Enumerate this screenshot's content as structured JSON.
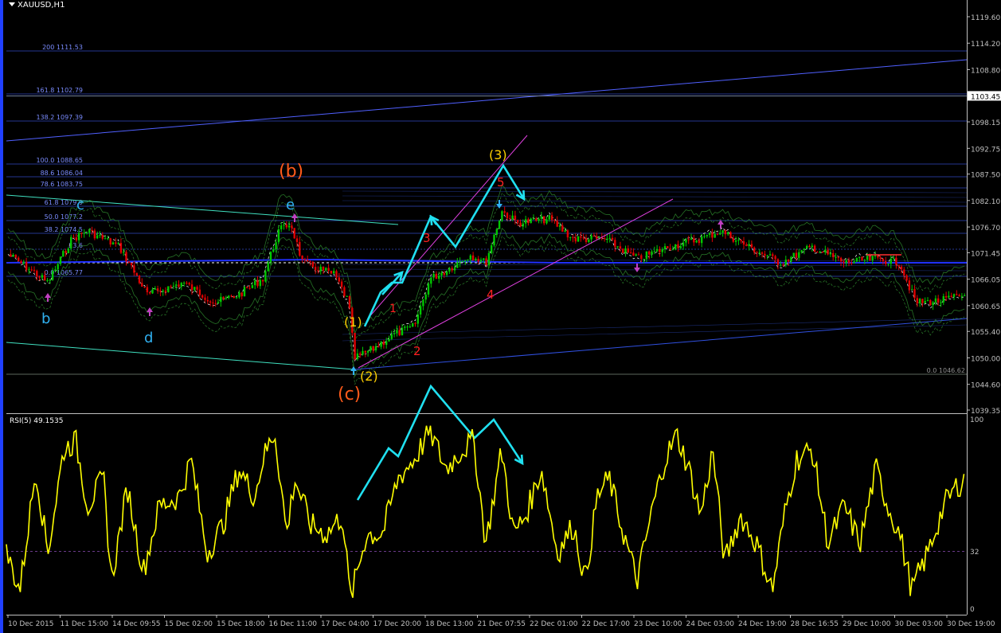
{
  "window": {
    "symbol_title": "XAUUSD,H1"
  },
  "colors": {
    "background": "#000000",
    "grid": "#1c1c1c",
    "axis_text": "#c0c0c0",
    "bull_candle": "#00c800",
    "bear_candle": "#e00000",
    "fib": "#4060ff",
    "envelope": "#2f8f2f",
    "channel": "#3050d0",
    "trendline": "#40e0c0",
    "wedge": "#e040e0",
    "arrow": "#20e0f0",
    "rsi": "#ffff00",
    "wave_orange": "#ff5a1a",
    "wave_yellow": "#ffd000",
    "wave_cyan": "#30b0f0",
    "wave_red": "#ff2020",
    "up_arrow": "#c040c0"
  },
  "price_axis": {
    "labels": [
      "1119.60",
      "1114.20",
      "1108.80",
      "1103.45",
      "1098.15",
      "1092.75",
      "1087.50",
      "1082.10",
      "1076.70",
      "1071.45",
      "1066.05",
      "1060.65",
      "1055.40",
      "1050.00",
      "1044.60",
      "1039.35"
    ],
    "current_price": "1103.45"
  },
  "fib_levels": [
    {
      "ratio": "200",
      "price": "1111.53"
    },
    {
      "ratio": "161.8",
      "price": "1102.79"
    },
    {
      "ratio": "138.2",
      "price": "1097.39"
    },
    {
      "ratio": "100.0",
      "price": "1088.65"
    },
    {
      "ratio": "88.6",
      "price": "1086.04"
    },
    {
      "ratio": "78.6",
      "price": "1083.75"
    },
    {
      "ratio": "61.8",
      "price": "1079.9"
    },
    {
      "ratio": "50.0",
      "price": "1077.2"
    },
    {
      "ratio": "38.2",
      "price": "1074.5"
    },
    {
      "ratio": "23.6",
      "price": ""
    },
    {
      "ratio": "0.0",
      "price": "1065.77"
    }
  ],
  "fib_zero_label": "0.0 1046.62",
  "time_axis": [
    "10 Dec 2015",
    "11 Dec 15:00",
    "14 Dec 09:55",
    "15 Dec 02:00",
    "15 Dec 18:00",
    "16 Dec 11:00",
    "17 Dec 04:00",
    "17 Dec 20:00",
    "18 Dec 13:00",
    "21 Dec 07:55",
    "22 Dec 01:00",
    "22 Dec 17:00",
    "23 Dec 10:00",
    "24 Dec 03:00",
    "24 Dec 19:00",
    "28 Dec 16:55",
    "29 Dec 10:00",
    "30 Dec 03:00",
    "30 Dec 19:00"
  ],
  "rsi": {
    "title": "RSI(5) 49.1535",
    "axis_labels": [
      "100",
      "32",
      "0"
    ]
  },
  "wave_labels": {
    "b_upper": "(b)",
    "c_lower": "(c)",
    "w1": "(1)",
    "w2": "(2)",
    "w3": "(3)",
    "b": "b",
    "c": "c",
    "d": "d",
    "e": "e",
    "s1": "1",
    "s2": "2",
    "s3": "3",
    "s4": "4",
    "s5": "5"
  }
}
